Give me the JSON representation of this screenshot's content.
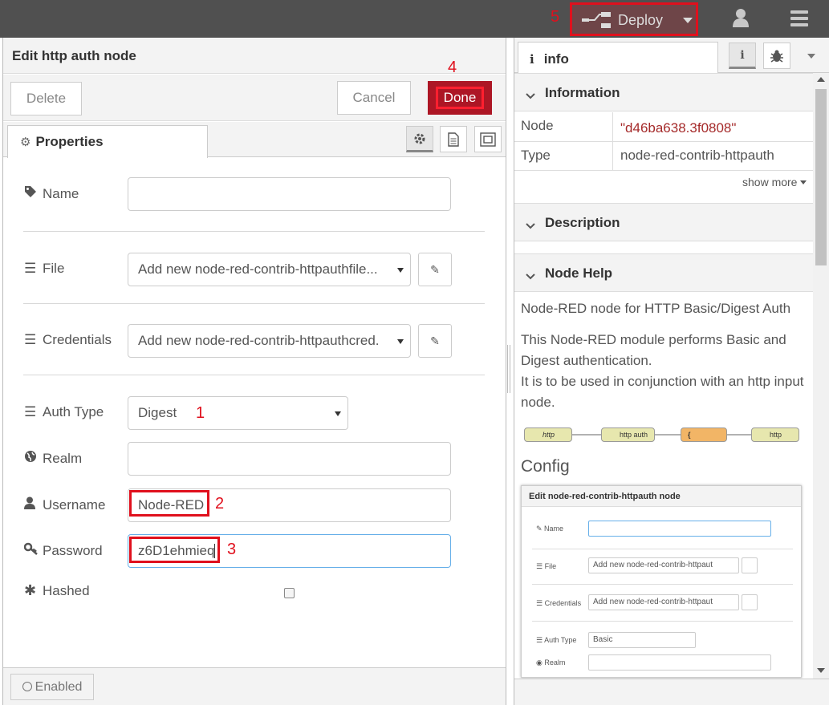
{
  "header": {
    "deploy_label": "Deploy",
    "annotation_5": "5"
  },
  "tray": {
    "title": "Edit http auth node",
    "delete_label": "Delete",
    "cancel_label": "Cancel",
    "done_label": "Done",
    "annotation_4": "4",
    "tab_properties": "Properties",
    "fields": {
      "name": {
        "label": "Name",
        "value": ""
      },
      "file": {
        "label": "File",
        "value": "Add new node-red-contrib-httpauthfile..."
      },
      "credentials": {
        "label": "Credentials",
        "value": "Add new node-red-contrib-httpauthcred."
      },
      "auth_type": {
        "label": "Auth Type",
        "value": "Digest",
        "annotation": "1"
      },
      "realm": {
        "label": "Realm",
        "value": ""
      },
      "username": {
        "label": "Username",
        "value": "Node-RED",
        "annotation": "2"
      },
      "password": {
        "label": "Password",
        "value": "z6D1ehmieq",
        "annotation": "3"
      },
      "hashed": {
        "label": "Hashed",
        "checked": false
      }
    },
    "enabled_label": "Enabled"
  },
  "sidebar": {
    "tab_info": "info",
    "information_title": "Information",
    "info_rows": [
      {
        "key": "Node",
        "value": "\"d46ba638.3f0808\""
      },
      {
        "key": "Type",
        "value": "node-red-contrib-httpauth"
      }
    ],
    "show_more": "show more",
    "description_title": "Description",
    "node_help_title": "Node Help",
    "help_line1": "Node-RED node for HTTP Basic/Digest Auth",
    "help_para": "This Node-RED module performs Basic and Digest authentication.",
    "help_para2": "It is to be used in conjunction with an http input node.",
    "flow_nodes": [
      "http",
      "http auth",
      "{",
      "http"
    ],
    "config_heading": "Config",
    "config_image": {
      "title": "Edit node-red-contrib-httpauth node",
      "name_label": "Name",
      "file_label": "File",
      "file_value": "Add new node-red-contrib-httpaut",
      "credentials_label": "Credentials",
      "credentials_value": "Add new node-red-contrib-httpaut",
      "auth_type_label": "Auth Type",
      "auth_type_value": "Basic",
      "realm_label": "Realm"
    }
  },
  "colors": {
    "header_bg": "#505050",
    "done_bg": "#ad1625",
    "annotation_red": "#e0101d",
    "node_id_color": "#a52a2a"
  }
}
